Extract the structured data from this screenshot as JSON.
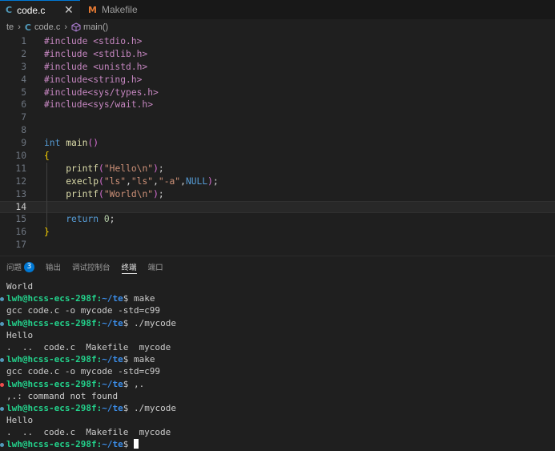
{
  "tabs": [
    {
      "icon": "C",
      "label": "code.c",
      "active": true,
      "close": "✕"
    },
    {
      "icon": "M",
      "label": "Makefile",
      "active": false
    }
  ],
  "breadcrumb": {
    "folder": "te",
    "icon": "C",
    "file": "code.c",
    "symbol": "main()"
  },
  "editor": {
    "active_line": 14,
    "lines": [
      {
        "n": "1",
        "text": "#include <stdio.h>"
      },
      {
        "n": "2",
        "text": "#include <stdlib.h>"
      },
      {
        "n": "3",
        "text": "#include <unistd.h>"
      },
      {
        "n": "4",
        "text": "#include<string.h>"
      },
      {
        "n": "5",
        "text": "#include<sys/types.h>"
      },
      {
        "n": "6",
        "text": "#include<sys/wait.h>"
      },
      {
        "n": "7",
        "text": ""
      },
      {
        "n": "8",
        "text": ""
      },
      {
        "n": "9",
        "text": "int main()"
      },
      {
        "n": "10",
        "text": "{"
      },
      {
        "n": "11",
        "text": "    printf(\"Hello\\n\");"
      },
      {
        "n": "12",
        "text": "    execlp(\"ls\",\"ls\",\"-a\",NULL);"
      },
      {
        "n": "13",
        "text": "    printf(\"World\\n\");"
      },
      {
        "n": "14",
        "text": ""
      },
      {
        "n": "15",
        "text": "    return 0;"
      },
      {
        "n": "16",
        "text": "}"
      },
      {
        "n": "17",
        "text": ""
      }
    ]
  },
  "panel": {
    "tabs": [
      "问题",
      "输出",
      "调试控制台",
      "终端",
      "端口"
    ],
    "problems_count": "3",
    "active_tab": "终端"
  },
  "terminal": {
    "user": "lwh@hcss-ecs-298f",
    "lines": [
      {
        "type": "out",
        "text": "World"
      },
      {
        "type": "prompt",
        "status": "ok",
        "path": "~/te",
        "cmd": " make"
      },
      {
        "type": "out",
        "text": "gcc code.c -o mycode -std=c99"
      },
      {
        "type": "prompt",
        "status": "ok",
        "path": "~/te",
        "cmd": " ./mycode"
      },
      {
        "type": "out",
        "text": "Hello"
      },
      {
        "type": "out",
        "text": ".  ..  code.c  Makefile  mycode"
      },
      {
        "type": "prompt",
        "status": "ok",
        "path": "~/te",
        "cmd": " make"
      },
      {
        "type": "out",
        "text": "gcc code.c -o mycode -std=c99"
      },
      {
        "type": "prompt",
        "status": "err",
        "path": "~/te",
        "cmd": " ,."
      },
      {
        "type": "out",
        "text": ",.: command not found"
      },
      {
        "type": "prompt",
        "status": "ok",
        "path": "~/te",
        "cmd": " ./mycode"
      },
      {
        "type": "out",
        "text": "Hello"
      },
      {
        "type": "out",
        "text": ".  ..  code.c  Makefile  mycode"
      },
      {
        "type": "prompt",
        "status": "ok",
        "path": "~/te",
        "cmd": " ",
        "cursor": true
      }
    ]
  },
  "colors": {
    "accent": "#0078d4",
    "prompt_user": "#23d18b",
    "prompt_path": "#3b8eea",
    "error": "#f14c4c"
  }
}
